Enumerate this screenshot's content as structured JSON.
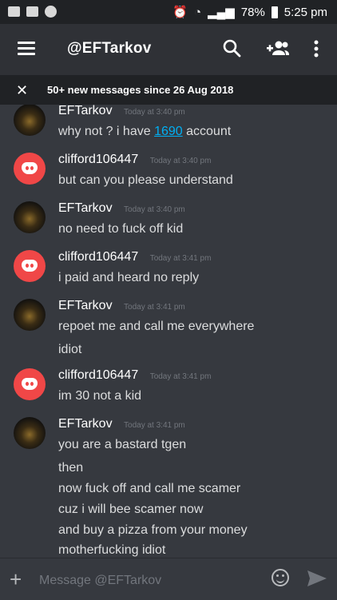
{
  "status_bar": {
    "battery": "78%",
    "time": "5:25 pm"
  },
  "header": {
    "title": "@EFTarkov"
  },
  "new_messages_bar": {
    "text": "50+ new messages since 26 Aug 2018"
  },
  "messages": [
    {
      "author": "EFTarkov",
      "timestamp": "Today at 3:40 pm",
      "avatar": "tarkov-avatar",
      "lines": [
        "why not ? i have ",
        "1690",
        " account"
      ]
    },
    {
      "author": "clifford106447",
      "timestamp": "Today at 3:40 pm",
      "avatar": "discord-avatar",
      "lines": [
        "but can you please understand"
      ]
    },
    {
      "author": "EFTarkov",
      "timestamp": "Today at 3:40 pm",
      "avatar": "tarkov-avatar",
      "lines": [
        "no need to fuck off kid"
      ]
    },
    {
      "author": "clifford106447",
      "timestamp": "Today at 3:41 pm",
      "avatar": "discord-avatar",
      "lines": [
        "i paid and heard no reply"
      ]
    },
    {
      "author": "EFTarkov",
      "timestamp": "Today at 3:41 pm",
      "avatar": "tarkov-avatar",
      "lines": [
        "repoet me and call me everywhere",
        "idiot"
      ]
    },
    {
      "author": "clifford106447",
      "timestamp": "Today at 3:41 pm",
      "avatar": "discord-avatar",
      "lines": [
        "im 30 not a kid"
      ]
    },
    {
      "author": "EFTarkov",
      "timestamp": "Today at 3:41 pm",
      "avatar": "tarkov-avatar",
      "lines": [
        "you are a bastard tgen",
        "then",
        "now fuck off and call me scamer",
        "cuz i will bee scamer now",
        "and buy a pizza from your money",
        "motherfucking idiot"
      ]
    }
  ],
  "composer": {
    "placeholder": "Message @EFTarkov"
  },
  "icons": {
    "brand_red": "#f04747",
    "link_blue": "#00b0f4"
  }
}
